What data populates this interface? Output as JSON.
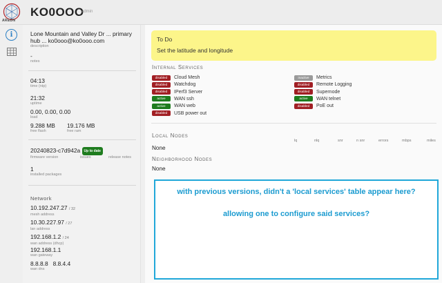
{
  "header": {
    "logo_text": "AREDN",
    "node_name": "KO0OOO",
    "user_tag": "admin"
  },
  "status": {
    "description": {
      "value": "Lone Mountain and Valley Dr ... primary hub ... ko0ooo@ko0ooo.com",
      "label": "description"
    },
    "notes": {
      "value": "-",
      "label": "notes"
    },
    "time": {
      "value": "04:13",
      "label": "time (ntp)"
    },
    "uptime": {
      "value": "21:32",
      "label": "uptime"
    },
    "load": {
      "value": "0.00, 0.00, 0.00",
      "label": "load"
    },
    "flash": {
      "value": "9.288 MB",
      "label": "free flash"
    },
    "ram": {
      "value": "19.176 MB",
      "label": "free ram"
    },
    "firmware": {
      "value": "20240823-c7d942a",
      "badge": "Up to date",
      "label": "firmware version",
      "issues": "issues",
      "release_notes": "release notes"
    },
    "packages": {
      "value": "1",
      "label": "installed packages"
    },
    "network_title": "Network",
    "mesh": {
      "value": "10.192.247.27",
      "suffix": "/ 32",
      "label": "mesh address"
    },
    "lan": {
      "value": "10.30.227.97",
      "suffix": "/ 27",
      "label": "lan address"
    },
    "wan": {
      "value": "192.168.1.2",
      "suffix": "/ 24",
      "label": "wan address (dhcp)"
    },
    "gateway": {
      "value": "192.168.1.1",
      "label": "wan gateway"
    },
    "dns": {
      "value": "8.8.8.8   8.8.4.4",
      "label": "wan dns"
    }
  },
  "todo": {
    "title": "To Do",
    "item": "Set the latitude and longitude"
  },
  "internal_services": {
    "title": "Internal Services",
    "left": [
      {
        "status": "disabled",
        "name": "Cloud Mesh",
        "color": "#a11f24"
      },
      {
        "status": "disabled",
        "name": "Watchdog",
        "color": "#a11f24"
      },
      {
        "status": "disabled",
        "name": "IPerf3 Server",
        "color": "#a11f24"
      },
      {
        "status": "active",
        "name": "WAN ssh",
        "color": "#1e7c1e"
      },
      {
        "status": "active",
        "name": "WAN web",
        "color": "#1e7c1e"
      },
      {
        "status": "disabled",
        "name": "USB power out",
        "color": "#a11f24"
      }
    ],
    "right": [
      {
        "status": "inactive",
        "name": "Metrics",
        "color": "#9a9a9a"
      },
      {
        "status": "disabled",
        "name": "Remote Logging",
        "color": "#a11f24"
      },
      {
        "status": "disabled",
        "name": "Supernode",
        "color": "#a11f24"
      },
      {
        "status": "active",
        "name": "WAN telnet",
        "color": "#1e7c1e"
      },
      {
        "status": "disabled",
        "name": "PoE out",
        "color": "#a11f24"
      }
    ]
  },
  "local_nodes": {
    "title": "Local Nodes",
    "columns": [
      "lq",
      "nlq",
      "snr",
      "n snr",
      "errors",
      "mbps",
      "miles"
    ],
    "empty": "None"
  },
  "neighborhood_nodes": {
    "title": "Neighborhood Nodes",
    "empty": "None"
  },
  "annotation": {
    "line1": "with previous versions, didn't a 'local services' table appear here?",
    "line2": "allowing one to configure said services?",
    "border_color": "#1fa7d9"
  }
}
